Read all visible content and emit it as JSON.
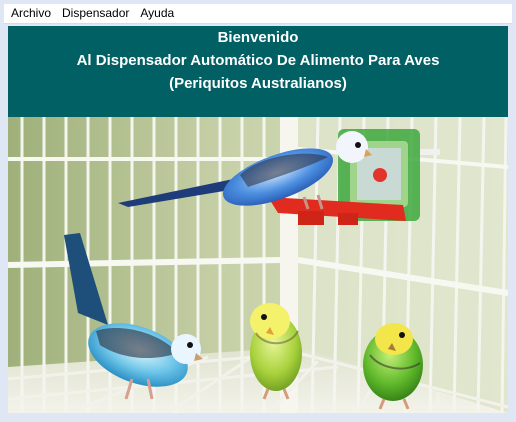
{
  "menu": {
    "items": [
      "Archivo",
      "Dispensador",
      "Ayuda"
    ]
  },
  "banner": {
    "line1": "Bienvenido",
    "line2": "Al Dispensador Automático De Alimento Para Aves",
    "line3": "(Periquitos Australianos)"
  },
  "colors": {
    "banner_bg": "#006063",
    "banner_text": "#ffffff",
    "menubar_bg": "#ffffff",
    "frame_bg": "#dfe7f5"
  },
  "image": {
    "subject": "four budgerigars in a white wire cage with a green mirror toy"
  }
}
